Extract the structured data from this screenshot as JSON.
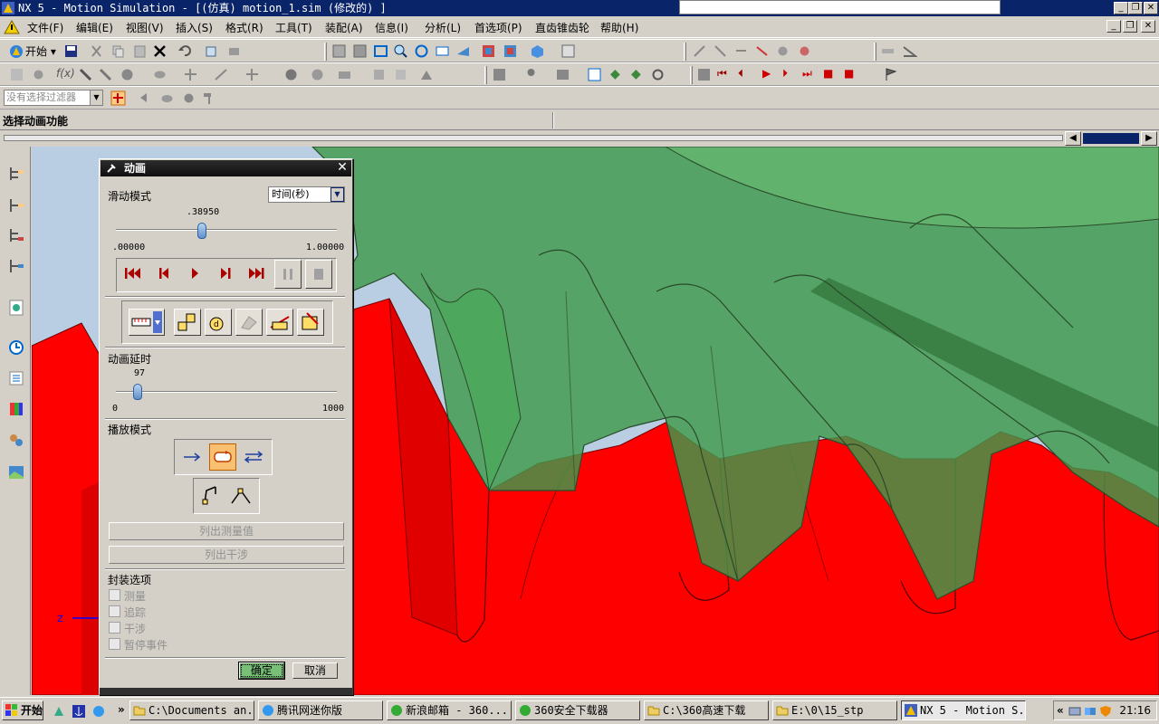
{
  "window": {
    "title": "NX 5 - Motion Simulation - [(仿真) motion_1.sim (修改的) ]",
    "controls": [
      "_",
      "❐",
      "✕"
    ]
  },
  "menubar": {
    "items": [
      "文件(F)",
      "编辑(E)",
      "视图(V)",
      "插入(S)",
      "格式(R)",
      "工具(T)",
      "装配(A)",
      "信息(I)",
      "分析(L)",
      "首选项(P)",
      "直齿锥齿轮",
      "帮助(H)"
    ]
  },
  "toolbar": {
    "start_label": "开始",
    "filter_placeholder": "没有选择过滤器"
  },
  "status": {
    "prompt": "选择动画功能"
  },
  "dialog": {
    "title": "动画",
    "slide_mode_label": "滑动模式",
    "slide_mode_value": "时间(秒)",
    "time_value": ".38950",
    "time_position": 0.3895,
    "time_min": ".00000",
    "time_max": "1.00000",
    "delay_label": "动画延时",
    "delay_value": "97",
    "delay_fraction": 0.097,
    "delay_min": "0",
    "delay_max": "1000",
    "play_mode_label": "播放模式",
    "list_measure_label": "列出测量值",
    "list_interference_label": "列出干涉",
    "package_options_label": "封装选项",
    "checkboxes": [
      "测量",
      "追踪",
      "干涉",
      "暂停事件"
    ],
    "ok_label": "确定",
    "cancel_label": "取消"
  },
  "taskbar": {
    "start_label": "开始",
    "tasks": [
      "C:\\Documents an...",
      "腾讯网迷你版",
      "新浪邮箱 - 360...",
      "360安全下载器",
      "C:\\360高速下载",
      "E:\\0\\15_stp",
      "NX 5 - Motion S..."
    ],
    "clock": "21:16",
    "chevron": "»",
    "tray_chevron": "«"
  },
  "colors": {
    "title_bar": "#0a246a",
    "gear_red": "#ff0000",
    "gear_green": "#3f9a4c",
    "background": "#d4d0c8"
  }
}
